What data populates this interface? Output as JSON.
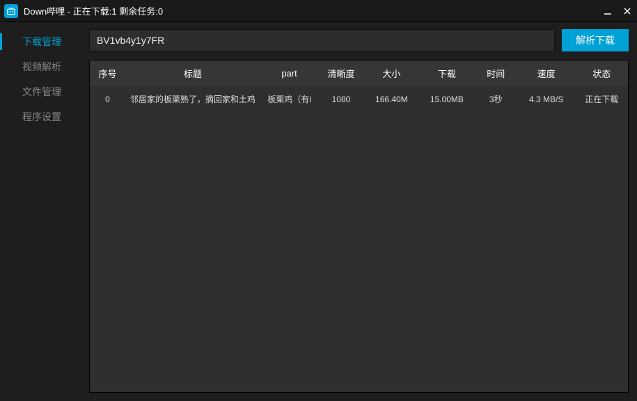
{
  "titlebar": {
    "title": "Down哔哩 - 正在下载:1  剩余任务:0"
  },
  "sidebar": {
    "items": [
      {
        "label": "下载管理",
        "active": true
      },
      {
        "label": "视频解析",
        "active": false
      },
      {
        "label": "文件管理",
        "active": false
      },
      {
        "label": "程序设置",
        "active": false
      }
    ]
  },
  "search": {
    "value": "BV1vb4y1y7FR",
    "button_label": "解析下载"
  },
  "table": {
    "headers": {
      "index": "序号",
      "title": "标题",
      "part": "part",
      "quality": "清晰度",
      "size": "大小",
      "downloaded": "下载",
      "time": "时间",
      "speed": "速度",
      "status": "状态"
    },
    "rows": [
      {
        "index": "0",
        "title": "邻居家的板栗熟了，摘回家和土鸡",
        "part": "板栗鸡（有l",
        "quality": "1080",
        "size": "166.40M",
        "downloaded": "15.00MB",
        "time": "3秒",
        "speed": "4.3 MB/S",
        "status": "正在下载"
      }
    ]
  }
}
